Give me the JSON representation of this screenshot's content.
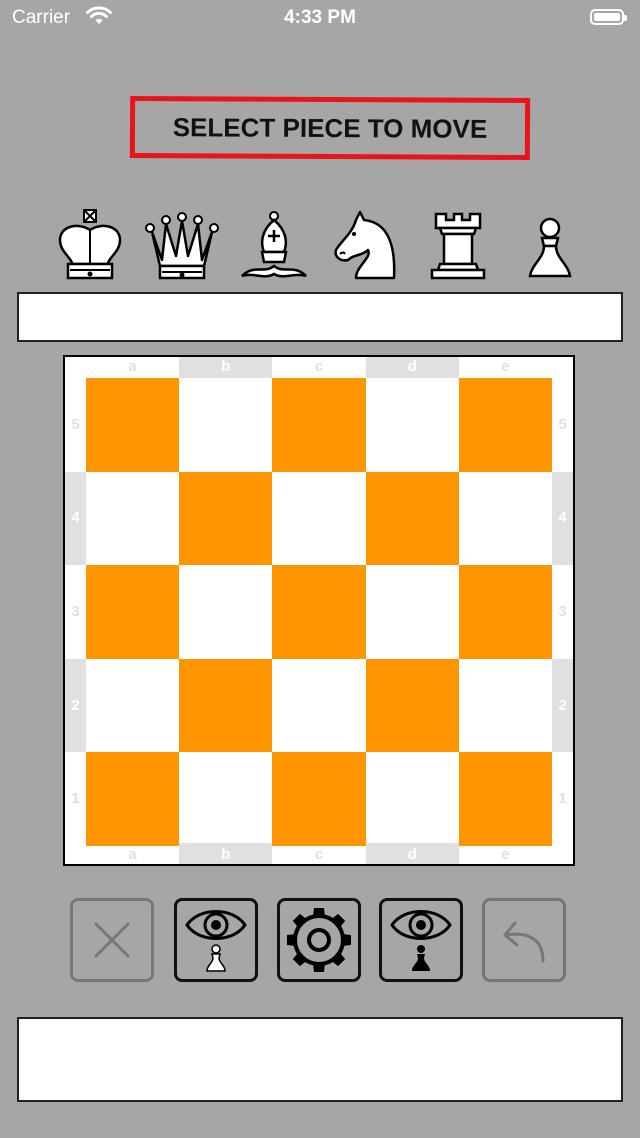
{
  "status_bar": {
    "carrier": "Carrier",
    "time": "4:33 PM"
  },
  "prompt": {
    "text": "SELECT PIECE TO MOVE",
    "border_color": "#e8141b"
  },
  "pieces": [
    {
      "name": "king",
      "icon": "king-icon"
    },
    {
      "name": "queen",
      "icon": "queen-icon"
    },
    {
      "name": "bishop",
      "icon": "bishop-icon"
    },
    {
      "name": "knight",
      "icon": "knight-icon"
    },
    {
      "name": "rook",
      "icon": "rook-icon"
    },
    {
      "name": "pawn",
      "icon": "pawn-icon"
    }
  ],
  "board": {
    "files": [
      "a",
      "b",
      "c",
      "d",
      "e"
    ],
    "ranks": [
      "5",
      "4",
      "3",
      "2",
      "1"
    ],
    "dark_color": "#ff9500",
    "light_color": "#ffffff"
  },
  "controls": [
    {
      "name": "close",
      "icon": "close-icon",
      "enabled": false
    },
    {
      "name": "view-white",
      "icon": "eye-white-pawn-icon",
      "enabled": true
    },
    {
      "name": "settings",
      "icon": "gear-icon",
      "enabled": true
    },
    {
      "name": "view-black",
      "icon": "eye-black-pawn-icon",
      "enabled": true
    },
    {
      "name": "undo",
      "icon": "undo-arrow-icon",
      "enabled": false
    }
  ],
  "info_top": {
    "text": ""
  },
  "info_bottom": {
    "text": ""
  }
}
